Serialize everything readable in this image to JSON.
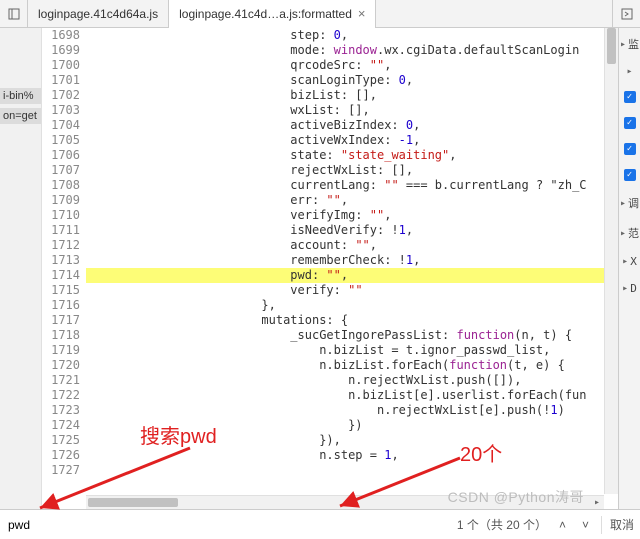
{
  "tabs": [
    {
      "label": "loginpage.41c4d64a.js",
      "active": false
    },
    {
      "label": "loginpage.41c4d…a.js:formatted",
      "active": true
    }
  ],
  "left_strip": {
    "frag1": "i-bin%",
    "frag2": "on=get"
  },
  "gutter_start": 1698,
  "code_lines": [
    {
      "indent": 28,
      "text": "step: 0,"
    },
    {
      "indent": 28,
      "text": "mode: window.wx.cgiData.defaultScanLogin"
    },
    {
      "indent": 28,
      "text": "qrcodeSrc: \"\","
    },
    {
      "indent": 28,
      "text": "scanLoginType: 0,"
    },
    {
      "indent": 28,
      "text": "bizList: [],"
    },
    {
      "indent": 28,
      "text": "wxList: [],"
    },
    {
      "indent": 28,
      "text": "activeBizIndex: 0,"
    },
    {
      "indent": 28,
      "text": "activeWxIndex: -1,"
    },
    {
      "indent": 28,
      "text": "state: \"state_waiting\","
    },
    {
      "indent": 28,
      "text": "rejectWxList: [],"
    },
    {
      "indent": 28,
      "text": "currentLang: \"\" === b.currentLang ? \"zh_C"
    },
    {
      "indent": 28,
      "text": "err: \"\","
    },
    {
      "indent": 28,
      "text": "verifyImg: \"\","
    },
    {
      "indent": 28,
      "text": "isNeedVerify: !1,"
    },
    {
      "indent": 28,
      "text": "account: \"\","
    },
    {
      "indent": 28,
      "text": "rememberCheck: !1,"
    },
    {
      "indent": 28,
      "text": "pwd: \"\",",
      "highlight": true
    },
    {
      "indent": 28,
      "text": "verify: \"\""
    },
    {
      "indent": 24,
      "text": "},"
    },
    {
      "indent": 24,
      "text": "mutations: {"
    },
    {
      "indent": 28,
      "text": "_sucGetIngorePassList: function(n, t) {"
    },
    {
      "indent": 32,
      "text": "n.bizList = t.ignor_passwd_list,"
    },
    {
      "indent": 32,
      "text": "n.bizList.forEach(function(t, e) {"
    },
    {
      "indent": 36,
      "text": "n.rejectWxList.push([]),"
    },
    {
      "indent": 36,
      "text": "n.bizList[e].userlist.forEach(fun"
    },
    {
      "indent": 40,
      "text": "n.rejectWxList[e].push(!1)"
    },
    {
      "indent": 36,
      "text": "})"
    },
    {
      "indent": 32,
      "text": "}),"
    },
    {
      "indent": 32,
      "text": "n.step = 1,"
    },
    {
      "indent": 0,
      "text": ""
    }
  ],
  "right_panel": {
    "rows": [
      {
        "type": "chev-label",
        "label": "监"
      },
      {
        "type": "chev"
      },
      {
        "type": "check"
      },
      {
        "type": "check"
      },
      {
        "type": "check"
      },
      {
        "type": "check"
      },
      {
        "type": "chev-label",
        "label": "调"
      },
      {
        "type": "chev-label",
        "label": "范"
      },
      {
        "type": "chev-label",
        "label": "X"
      },
      {
        "type": "chev-label",
        "label": "D"
      }
    ]
  },
  "search": {
    "value": "pwd",
    "count_text": "1 个（共 20 个）",
    "cancel": "取消"
  },
  "annotations": {
    "left": "搜索pwd",
    "right": "20个"
  },
  "watermark": "CSDN @Python涛哥"
}
